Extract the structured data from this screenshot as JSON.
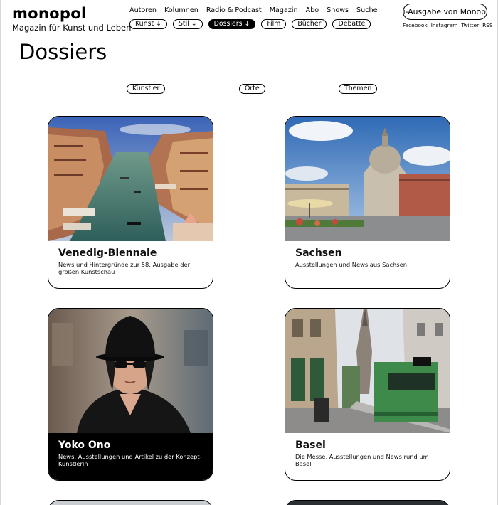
{
  "header": {
    "logo": "monopol",
    "tagline": "Magazin für Kunst und Leben",
    "nav": [
      "Autoren",
      "Kolumnen",
      "Radio & Podcast",
      "Magazin",
      "Abo",
      "Shows",
      "Suche"
    ],
    "sections": [
      {
        "label": "Kunst ↓",
        "active": false
      },
      {
        "label": "Stil ↓",
        "active": false
      },
      {
        "label": "Dossiers ↓",
        "active": true
      },
      {
        "label": "Film",
        "active": false
      },
      {
        "label": "Bücher",
        "active": false
      },
      {
        "label": "Debatte",
        "active": false
      }
    ],
    "epaper_label": "hi-Ausgabe von Monop",
    "social": [
      "Facebook",
      "Instagram",
      "Twitter",
      "RSS"
    ]
  },
  "page": {
    "title": "Dossiers",
    "filters": [
      "Künstler",
      "Orte",
      "Themen"
    ]
  },
  "cards": [
    {
      "title": "Venedig-Biennale",
      "description": "News und Hintergründe zur 58. Ausgabe der großen Kunstschau",
      "image": "venice-canal"
    },
    {
      "title": "Sachsen",
      "description": "Ausstellungen und News aus Sachsen",
      "image": "dresden-frauenkirche"
    },
    {
      "title": "Yoko Ono",
      "description": "News, Ausstellungen und Artikel zu der Konzept-Künstlerin",
      "image": "yoko-ono-portrait"
    },
    {
      "title": "Basel",
      "description": "Die Messe, Ausstellungen und News rund um Basel",
      "image": "basel-tram-street"
    }
  ],
  "colors": {
    "accent": "#000000",
    "background": "#ffffff"
  }
}
